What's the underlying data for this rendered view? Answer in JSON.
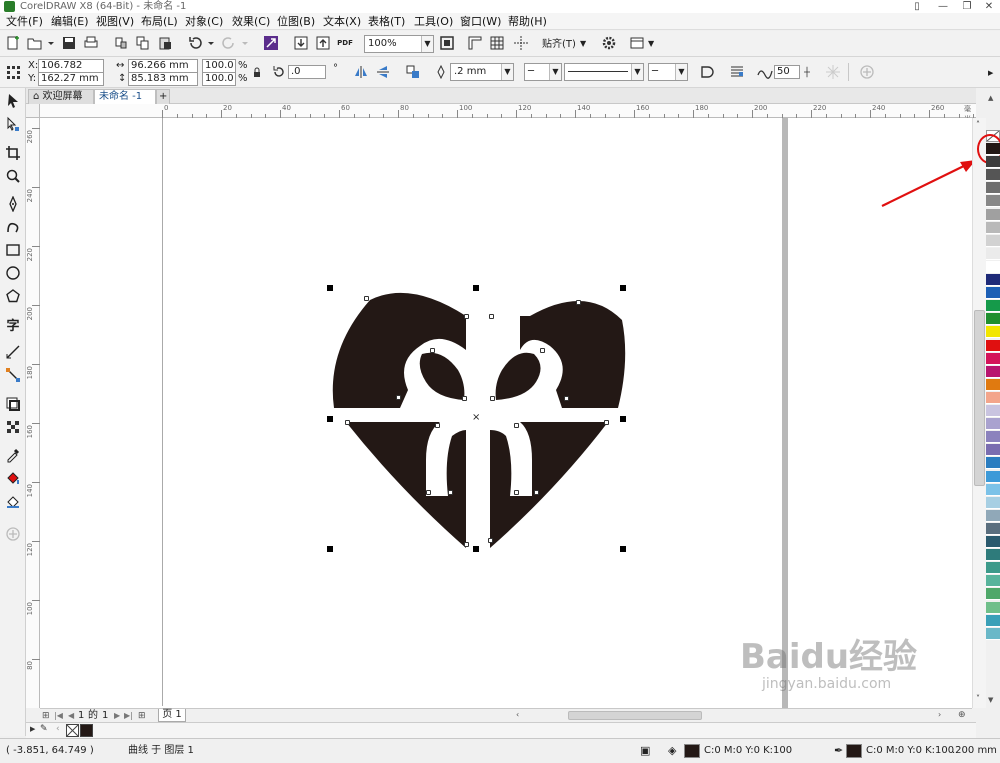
{
  "window": {
    "title": "CorelDRAW X8 (64-Bit) - 未命名 -1"
  },
  "menu": [
    "文件(F)",
    "编辑(E)",
    "视图(V)",
    "布局(L)",
    "对象(C)",
    "效果(C)",
    "位图(B)",
    "文本(X)",
    "表格(T)",
    "工具(O)",
    "窗口(W)",
    "帮助(H)"
  ],
  "standard_toolbar": {
    "zoom": "100%",
    "snap_label": "贴齐(T)",
    "pdf_label": "PDF"
  },
  "property_bar": {
    "x": "106.782 mm",
    "y": "162.27 mm",
    "width": "96.266 mm",
    "height": "85.183 mm",
    "scale_x": "100.0",
    "scale_y": "100.0",
    "percent": "%",
    "x_label": "X:",
    "y_label": "Y:",
    "rotation": ".0",
    "degree": "°",
    "outline_width": ".2 mm",
    "smoothing": "50"
  },
  "tabs": {
    "welcome": "欢迎屏幕",
    "document": "未命名 -1"
  },
  "ruler_h": [
    "0",
    "20",
    "40",
    "60",
    "80",
    "100",
    "120",
    "140",
    "160",
    "180",
    "200",
    "220",
    "240",
    "260"
  ],
  "ruler_h_unit": "毫米",
  "ruler_v": [
    "260",
    "240",
    "220",
    "200",
    "180",
    "160",
    "140",
    "120",
    "100",
    "80"
  ],
  "page_nav": {
    "current": "1",
    "of": "的",
    "total": "1",
    "page_tab": "页 1"
  },
  "status": {
    "coords": "( -3.851, 64.749 )",
    "object_info": "曲线 于 图层 1",
    "fill": "C:0 M:0 Y:0 K:100",
    "outline": "C:0 M:0 Y:0 K:100",
    "outline_width": ".200 mm"
  },
  "watermark": {
    "brand": "Baidu经验",
    "url": "jingyan.baidu.com"
  },
  "colors": {
    "fill": "#231815",
    "accent_red": "#e01010",
    "page_shadow": "#b8b8b8"
  }
}
